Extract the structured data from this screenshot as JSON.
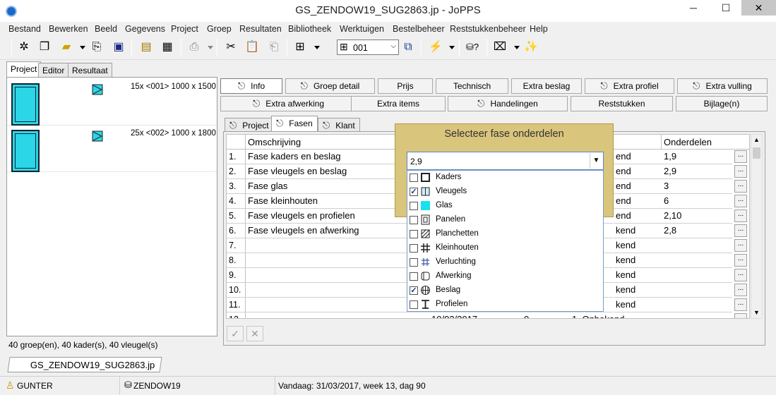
{
  "window": {
    "title": "GS_ZENDOW19_SUG2863.jp - JoPPS",
    "minimize": "─",
    "maximize": "☐",
    "close": "✕"
  },
  "menu": [
    "Bestand",
    "Bewerken",
    "Beeld",
    "Gegevens",
    "Project",
    "Groep",
    "Resultaten",
    "Bibliotheek",
    "Werktuigen",
    "Bestelbeheer",
    "Reststukkenbeheer",
    "Help"
  ],
  "toolbar": {
    "combo_value": "001"
  },
  "left_tabs": [
    "Project",
    "Editor",
    "Resultaat"
  ],
  "left_items": [
    {
      "desc": "15x <001> 1000 x 1500"
    },
    {
      "desc": "25x <002> 1000 x 1800"
    }
  ],
  "left_status": "40 groep(en), 40 kader(s), 40 vleugel(s)",
  "buttons_row1": [
    "Info",
    "Groep detail",
    "Prijs",
    "Technisch",
    "Extra beslag",
    "Extra profiel",
    "Extra vulling"
  ],
  "buttons_row2": [
    "Extra afwerking",
    "Extra items",
    "Handelingen",
    "Reststukken",
    "Bijlage(n)"
  ],
  "sub_tabs": [
    "Project",
    "Fasen",
    "Klant"
  ],
  "grid": {
    "headers": {
      "omschrijving": "Omschrijving",
      "onderdelen": "Onderdelen"
    },
    "rows": [
      {
        "num": "1.",
        "omschrijving": "Fase kaders en beslag",
        "status": "end",
        "onderdelen": "1,9"
      },
      {
        "num": "2.",
        "omschrijving": "Fase vleugels en beslag",
        "status": "end",
        "onderdelen": "2,9"
      },
      {
        "num": "3.",
        "omschrijving": "Fase glas",
        "status": "end",
        "onderdelen": "3"
      },
      {
        "num": "4.",
        "omschrijving": "Fase kleinhouten",
        "status": "end",
        "onderdelen": "6"
      },
      {
        "num": "5.",
        "omschrijving": "Fase vleugels en profielen",
        "status": "end",
        "onderdelen": "2,10"
      },
      {
        "num": "6.",
        "omschrijving": "Fase vleugels en afwerking",
        "status": "kend",
        "onderdelen": "2,8"
      },
      {
        "num": "7.",
        "omschrijving": "",
        "status": "kend",
        "onderdelen": ""
      },
      {
        "num": "8.",
        "omschrijving": "",
        "status": "kend",
        "onderdelen": ""
      },
      {
        "num": "9.",
        "omschrijving": "",
        "status": "kend",
        "onderdelen": ""
      },
      {
        "num": "10.",
        "omschrijving": "",
        "status": "kend",
        "onderdelen": ""
      },
      {
        "num": "11.",
        "omschrijving": "",
        "status": "kend",
        "onderdelen": ""
      },
      {
        "num": "12.",
        "omschrijving": "",
        "status": "",
        "onderdelen": ""
      }
    ],
    "row12_extra": {
      "date": "10/02/2017",
      "qty": "0",
      "status": "1. Onbekend"
    },
    "dots": "..."
  },
  "confirm": {
    "ok": "✓",
    "cancel": "✕"
  },
  "popup": {
    "title": "Selecteer fase onderdelen",
    "combo_value": "2,9",
    "items": [
      {
        "label": "Kaders",
        "checked": false,
        "icon": "kaders-icon"
      },
      {
        "label": "Vleugels",
        "checked": true,
        "icon": "vleugels-icon"
      },
      {
        "label": "Glas",
        "checked": false,
        "icon": "glas-icon"
      },
      {
        "label": "Panelen",
        "checked": false,
        "icon": "panelen-icon"
      },
      {
        "label": "Planchetten",
        "checked": false,
        "icon": "planchetten-icon"
      },
      {
        "label": "Kleinhouten",
        "checked": false,
        "icon": "kleinhouten-icon"
      },
      {
        "label": "Verluchting",
        "checked": false,
        "icon": "verluchting-icon"
      },
      {
        "label": "Afwerking",
        "checked": false,
        "icon": "afwerking-icon"
      },
      {
        "label": "Beslag",
        "checked": true,
        "icon": "beslag-icon"
      },
      {
        "label": "Profielen",
        "checked": false,
        "icon": "profielen-icon"
      }
    ]
  },
  "file_tab": "GS_ZENDOW19_SUG2863.jp",
  "statusbar": {
    "user": "GUNTER",
    "db": "ZENDOW19",
    "date": "Vandaag: 31/03/2017, week 13, dag 90"
  }
}
